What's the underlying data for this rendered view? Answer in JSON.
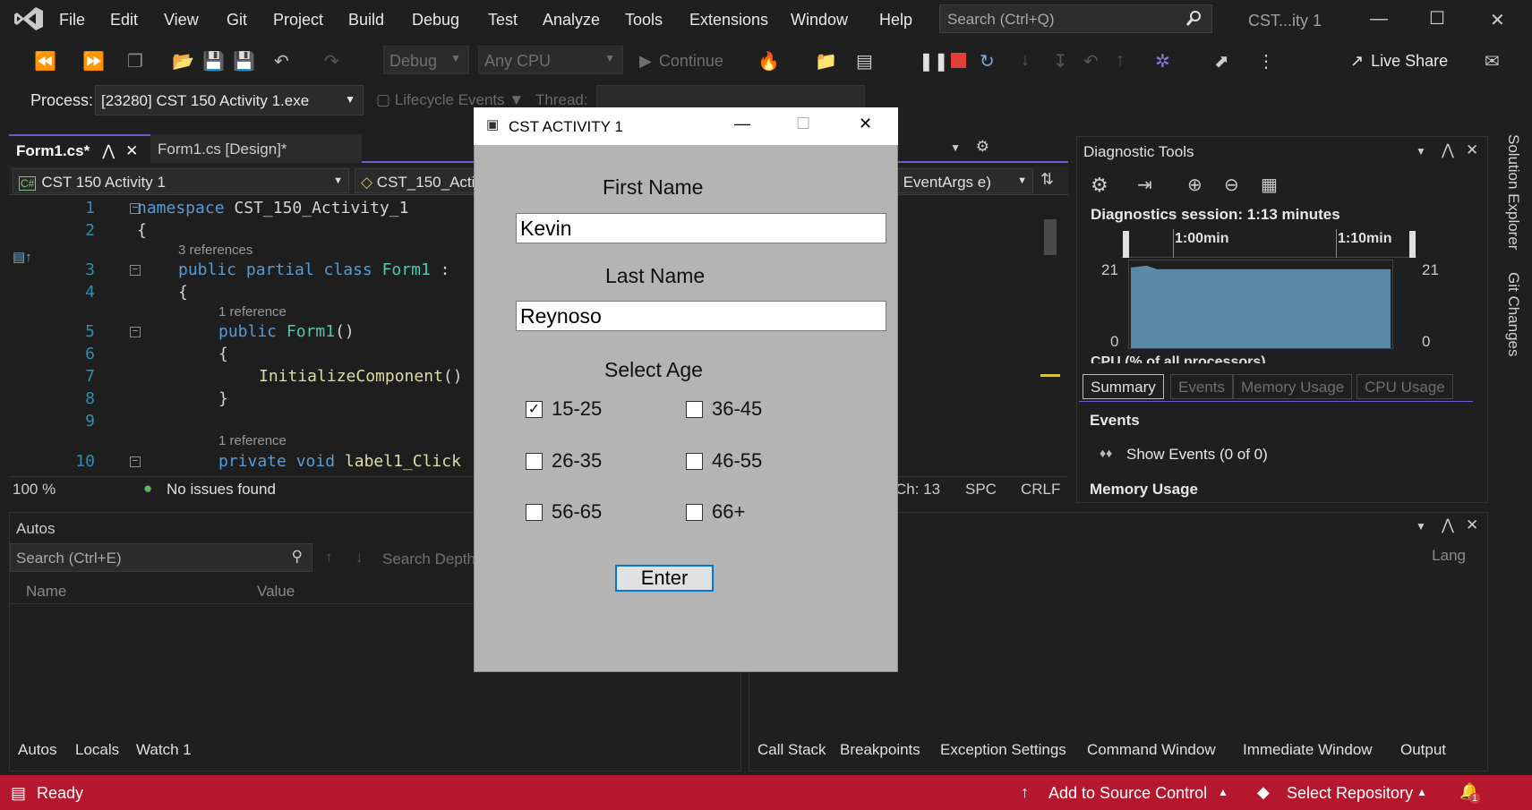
{
  "menu": {
    "items": [
      "File",
      "Edit",
      "View",
      "Git",
      "Project",
      "Build",
      "Debug",
      "Test",
      "Analyze",
      "Tools",
      "Extensions",
      "Window",
      "Help"
    ],
    "search_placeholder": "Search (Ctrl+Q)",
    "title": "CST...ity 1"
  },
  "toolbar": {
    "config": "Debug",
    "platform": "Any CPU",
    "continue": "Continue",
    "live_share": "Live Share",
    "process_label": "Process:",
    "process_value": "[23280] CST 150 Activity 1.exe",
    "lifecycle": "Lifecycle Events",
    "thread_label": "Thread:"
  },
  "editor": {
    "tabs": [
      "Form1.cs*",
      "Form1.cs [Design]*"
    ],
    "nav_project": "CST 150 Activity 1",
    "nav_class": "CST_150_Acti",
    "nav_member": "er, EventArgs e)",
    "refs": {
      "r3": "3 references",
      "r1a": "1 reference",
      "r1b": "1 reference"
    },
    "zoom": "100 %",
    "issues": "No issues found",
    "ch": "Ch: 13",
    "spc": "SPC",
    "crlf": "CRLF"
  },
  "diagnostic": {
    "title": "Diagnostic Tools",
    "session": "Diagnostics session: 1:13 minutes",
    "t1": "1:00min",
    "t2": "1:10min",
    "y_max": "21",
    "y_min": "0",
    "cpu_label": "CPU (% of all processors)",
    "tabs": [
      "Summary",
      "Events",
      "Memory Usage",
      "CPU Usage"
    ],
    "events_heading": "Events",
    "show_events": "Show Events (0 of 0)",
    "memory_heading": "Memory Usage"
  },
  "autos": {
    "title": "Autos",
    "search_placeholder": "Search (Ctrl+E)",
    "search_depth": "Search Depth",
    "col_name": "Name",
    "col_value": "Value",
    "tabs": [
      "Autos",
      "Locals",
      "Watch 1"
    ]
  },
  "callstack": {
    "col_lang": "Lang",
    "tabs": [
      "Call Stack",
      "Breakpoints",
      "Exception Settings",
      "Command Window",
      "Immediate Window",
      "Output"
    ]
  },
  "right_rail": [
    "Solution Explorer",
    "Git Changes"
  ],
  "status": {
    "ready": "Ready",
    "add_source": "Add to Source Control",
    "select_repo": "Select Repository",
    "notif_count": "1"
  },
  "form": {
    "title": "CST ACTIVITY 1",
    "first_name_label": "First Name",
    "first_name_value": "Kevin",
    "last_name_label": "Last Name",
    "last_name_value": "Reynoso",
    "age_label": "Select Age",
    "ages": [
      {
        "label": "15-25",
        "checked": true
      },
      {
        "label": "36-45",
        "checked": false
      },
      {
        "label": "26-35",
        "checked": false
      },
      {
        "label": "46-55",
        "checked": false
      },
      {
        "label": "56-65",
        "checked": false
      },
      {
        "label": "66+",
        "checked": false
      }
    ],
    "enter": "Enter"
  },
  "colors": {
    "accent": "#6b5ccd",
    "status_bar": "#b5172f",
    "form_bg": "#b4b4b4",
    "chart_fill": "#5a8aa8"
  }
}
